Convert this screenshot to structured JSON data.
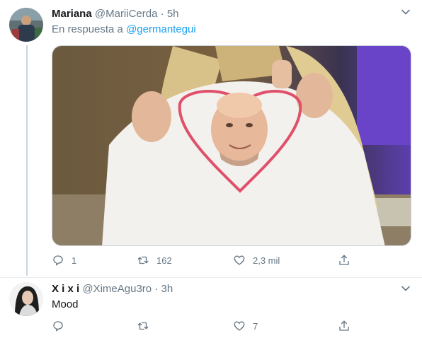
{
  "tweets": [
    {
      "name": "Mariana",
      "handle": "@MariiCerda",
      "separator": "·",
      "time": "5h",
      "reply_prefix": "En respuesta a",
      "reply_mention": "@germantegui",
      "has_media": true,
      "stats": {
        "replies": "1",
        "retweets": "162",
        "likes": "2,3 mil"
      }
    },
    {
      "name": "X i x i",
      "handle": "@XimeAgu3ro",
      "separator": "·",
      "time": "3h",
      "text": "Mood",
      "stats": {
        "replies": "",
        "retweets": "",
        "likes": "7"
      }
    }
  ],
  "icons": {
    "reply": "reply-icon",
    "retweet": "retweet-icon",
    "like": "heart-icon",
    "share": "share-icon",
    "menu": "chevron-down-icon"
  },
  "colors": {
    "accent": "#1da1f2",
    "secondary_text": "#657786",
    "icon": "#657786",
    "divider": "#e6ecf0"
  }
}
